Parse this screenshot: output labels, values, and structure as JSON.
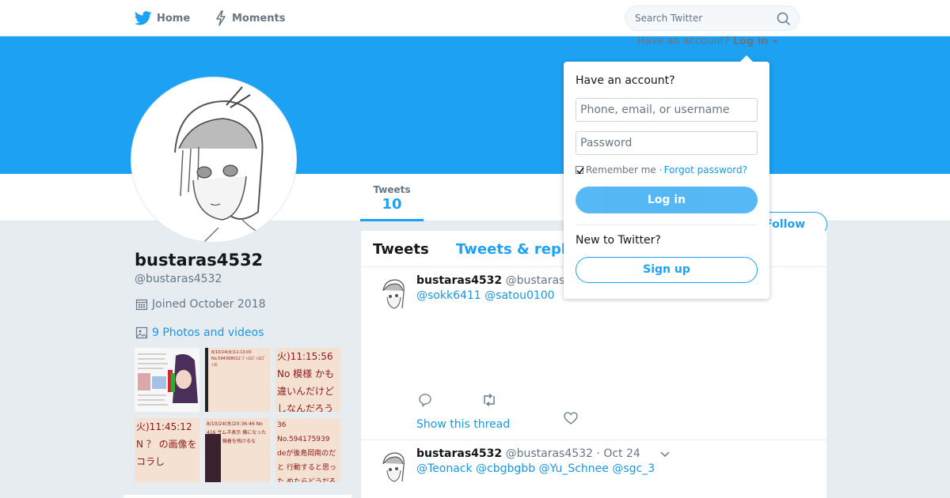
{
  "nav": {
    "home_label": "Home",
    "moments_label": "Moments",
    "search_placeholder": "Search Twitter"
  },
  "colors": {
    "brand_blue": "#1da1f2",
    "link_blue": "#1b95e0",
    "background": "#e6ecf0"
  },
  "stats": {
    "tweets_label": "Tweets",
    "tweets_value": "10"
  },
  "follow_label": "Follow",
  "profile": {
    "name": "bustaras4532",
    "handle": "@bustaras4532",
    "joined": "Joined October 2018",
    "photos_link": "9 Photos and videos",
    "thumbnails": [
      {
        "text": ""
      },
      {
        "text": "8/10/24(水)11:13:00 No.594368012 ｺﾞｯｽﾛｺﾞｯｽﾛｺﾞｯｽﾛ"
      },
      {
        "text": "火)11:15:56 No 模様 かも違いんだけど しなんだろうか"
      },
      {
        "text": "火)11:45:12 N ？ の画像をコラし"
      },
      {
        "text": "8/10/24(水)20:36:46 No 416 サムネ表示 横になったが高の 稿着を残けるな"
      },
      {
        "text": "36 No.594175939 deが後島岡南のだと 行動すると思った めたらどうだろう？"
      }
    ]
  },
  "timeline": {
    "tab_tweets": "Tweets",
    "tab_replies": "Tweets & repl",
    "tweets": [
      {
        "name": "bustaras4532",
        "handle": "@bustaras",
        "date": "",
        "body": "@sokk6411 @satou0100",
        "thread_link": "Show this thread"
      },
      {
        "name": "bustaras4532",
        "handle": "@bustaras4532",
        "date": "· Oct 24",
        "body": "@Teonack @cbgbgbb @Yu_Schnee @sgc_3"
      }
    ]
  },
  "login": {
    "top_prompt": "Have an account?",
    "top_link": "Log in",
    "title": "Have an account?",
    "username_placeholder": "Phone, email, or username",
    "password_placeholder": "Password",
    "remember_label": "Remember me",
    "separator": "·",
    "forgot_link": "Forgot password?",
    "login_button": "Log in",
    "new_prompt": "New to Twitter?",
    "signup_button": "Sign up"
  }
}
